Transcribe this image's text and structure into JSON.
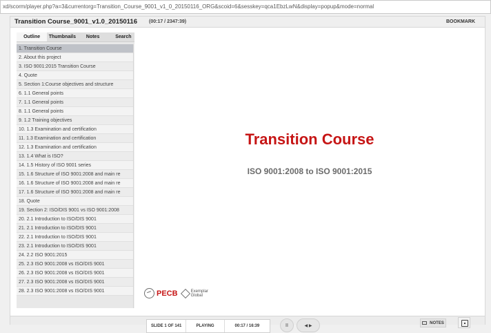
{
  "browser": {
    "url": "xd/scorm/player.php?a=3&currentorg=Transition_Course_9001_v1_0_20150116_ORG&scoid=6&sesskey=qca1EbzLwN&display=popup&mode=normal"
  },
  "player": {
    "title": "Transition Course_9001_v1.0_20150116",
    "duration": "(00:17 / 2347:39)",
    "bookmark": "BOOKMARK"
  },
  "sidebar": {
    "tabs": [
      {
        "label": "Outline"
      },
      {
        "label": "Thumbnails"
      },
      {
        "label": "Notes"
      },
      {
        "label": "Search"
      }
    ],
    "outline": [
      "1. Transition Course",
      "2. About this project",
      "3. ISO 9001:2015 Transition Course",
      "4. Quote",
      "5. Section 1:Course objectives and structure",
      "6. 1.1 General points",
      "7. 1.1 General points",
      "8. 1.1 General points",
      "9. 1.2 Training objectives",
      "10. 1.3 Examination and certification",
      "11. 1.3 Examination and certification",
      "12. 1.3 Examination and certification",
      "13. 1.4 What is ISO?",
      "14. 1.5 History of ISO 9001 series",
      "15. 1.6 Structure of ISO 9001:2008 and main re",
      "16. 1.6 Structure of ISO 9001:2008 and main re",
      "17. 1.6 Structure of ISO 9001:2008 and main re",
      "18. Quote",
      "19. Section 2: ISO/DIS 9001 vs ISO 9001:2008",
      "20. 2.1 Introduction to ISO/DIS 9001",
      "21. 2.1 Introduction to ISO/DIS 9001",
      "22. 2.1 Introduction to ISO/DIS 9001",
      "23. 2.1 Introduction to ISO/DIS 9001",
      "24. 2.2 ISO 9001:2015",
      "25. 2.3 ISO 9001:2008 vs ISO/DIS 9001",
      "26. 2.3 ISO 9001:2008 vs ISO/DIS 9001",
      "27. 2.3 ISO 9001:2008 vs ISO/DIS 9001",
      "28. 2.3 ISO 9001:2008 vs ISO/DIS 9001"
    ]
  },
  "slide": {
    "title": "Transition Course",
    "subtitle": "ISO 9001:2008 to ISO 9001:2015",
    "logo_text": "PECB",
    "partner_line1": "Exemplar",
    "partner_line2": "Global"
  },
  "controls": {
    "slide_count": "SLIDE 1 OF 141",
    "status": "PLAYING",
    "time": "00:17 / 16:39",
    "pause": "II",
    "prev_next": "◀ ▶",
    "notes": "NOTES"
  },
  "colors": {
    "accent": "#c61515"
  }
}
